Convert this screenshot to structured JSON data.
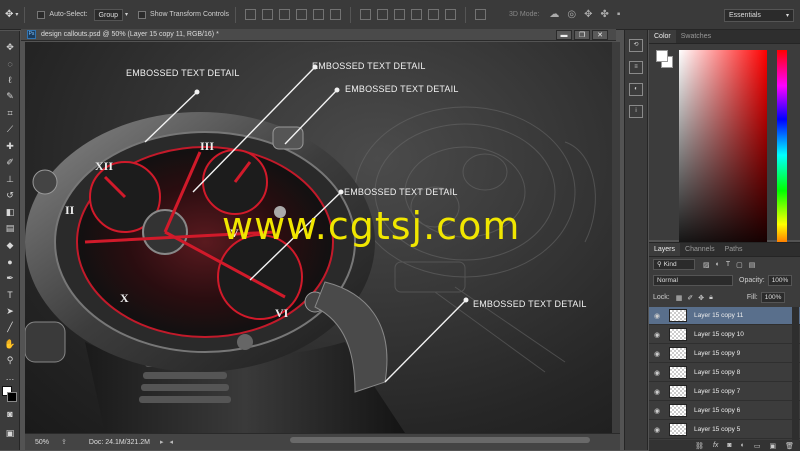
{
  "options_bar": {
    "auto_select_label": "Auto-Select:",
    "auto_select_value": "Group",
    "transform_controls_label": "Show Transform Controls",
    "mode_3d_label": "3D Mode:",
    "workspace_value": "Essentials"
  },
  "document": {
    "tab_title": "design callouts.psd @ 50% (Layer 15 copy 11, RGB/16) *",
    "zoom": "50%",
    "doc_size": "Doc: 24.1M/321.2M",
    "minimize": "▬",
    "restore": "❐",
    "close": "✕"
  },
  "canvas": {
    "callouts": [
      "EMBOSSED TEXT DETAIL",
      "EMBOSSED TEXT DETAIL",
      "EMBOSSED TEXT DETAIL",
      "EMBOSSED TEXT DETAIL",
      "EMBOSSED TEXT DETAIL"
    ],
    "watermark": "www.cgtsj.com"
  },
  "color_panel": {
    "tabs": [
      "Color",
      "Swatches"
    ],
    "fg_color": "#ffffff",
    "bg_color": "#ffffff"
  },
  "layers_panel": {
    "tabs": [
      "Layers",
      "Channels",
      "Paths"
    ],
    "filter_kind": "Kind",
    "blend_mode": "Normal",
    "opacity_label": "Opacity:",
    "opacity_value": "100%",
    "lock_label": "Lock:",
    "fill_label": "Fill:",
    "fill_value": "100%",
    "layers": [
      "Layer 15 copy 11",
      "Layer 15 copy 10",
      "Layer 15 copy 9",
      "Layer 15 copy 8",
      "Layer 15 copy 7",
      "Layer 15 copy 6",
      "Layer 15 copy 5"
    ],
    "selected_index": 0
  },
  "colors": {
    "accent_selection": "#596f8c",
    "watermark": "#f0e600",
    "watch_red": "#d11a2a"
  }
}
